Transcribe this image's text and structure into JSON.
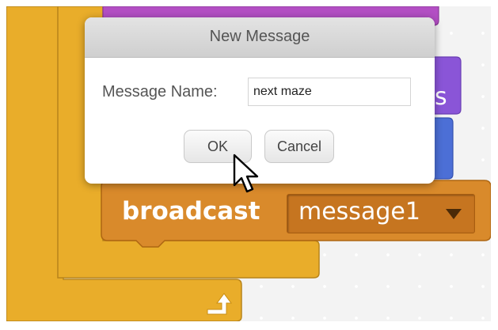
{
  "dialog": {
    "title": "New Message",
    "field_label": "Message Name:",
    "field_value": "next maze",
    "ok_label": "OK",
    "cancel_label": "Cancel"
  },
  "script_area": {
    "broadcast_block": {
      "label": "broadcast",
      "selected_message": "message1"
    },
    "hidden_block_fragments": [
      "s"
    ]
  },
  "icons": [
    "dropdown-arrow-icon",
    "loop-return-arrow-icon",
    "mouse-pointer-icon"
  ],
  "colors": {
    "control_block": "#e9ad2a",
    "events_block": "#d98a2b",
    "looks_block": "#8a55d7",
    "sound_block": "#b34fc4",
    "motion_block": "#4c6fd6",
    "canvas_background": "#f3f3f3",
    "dialog_header": "#d9d9d9"
  }
}
